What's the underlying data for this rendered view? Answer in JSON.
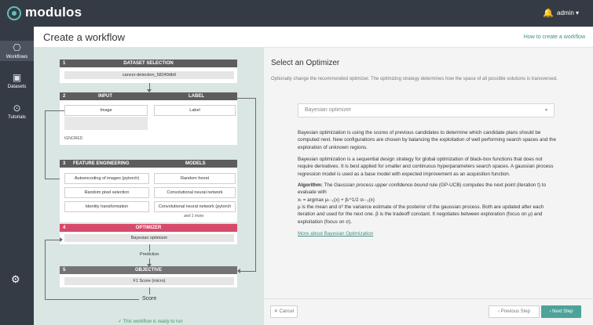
{
  "app": {
    "name": "modulos",
    "user": "admin",
    "user_caret": "▾"
  },
  "sidebar": {
    "items": [
      {
        "label": "Workflows",
        "icon": "workflow-icon"
      },
      {
        "label": "Datasets",
        "icon": "dataset-icon"
      },
      {
        "label": "Tutorials",
        "icon": "tutorials-icon"
      }
    ],
    "settings_icon": "gear-icon"
  },
  "header": {
    "title": "Create a workflow",
    "help_link": "How to create a workflow"
  },
  "diagram": {
    "dataset": {
      "num": "1",
      "title": "DATASET SELECTION",
      "value": "cancer-detection_58249db9"
    },
    "io": {
      "num": "2",
      "input_title": "INPUT",
      "label_title": "LABEL",
      "input": "Image",
      "label": "Label",
      "ignored": "IGNORED"
    },
    "fe": {
      "num": "3",
      "title": "FEATURE ENGINEERING",
      "models_title": "MODELS",
      "features": [
        "Autoencoding of images (pytorch)",
        "Random pixel selection",
        "Identity transformation"
      ],
      "models": [
        "Random forest",
        "Convolutional neural network",
        "Convolutional neural network (pytorch"
      ],
      "more": "and 1 more"
    },
    "optimizer": {
      "num": "4",
      "title": "OPTIMIZER",
      "value": "Bayesian optimizer"
    },
    "prediction": "Prediction",
    "objective": {
      "num": "5",
      "title": "OBJECTIVE",
      "value": "F1 Score (micro)"
    },
    "score": "Score",
    "ready": "✓ This workflow is ready to run"
  },
  "panel": {
    "title": "Select an Optimizer",
    "subtitle": "Optionally change the recommended optimizer. The optimizing strategy determines how the space of all possible solutions is transversed.",
    "select_value": "Bayesian optimizer",
    "p1": "Bayesian optimization is using the scores of previous candidates to determine which candidate plans should be computed next. New configurations are chosen by balancing the exploitation of well performing search spaces and the exploration of unknown regions.",
    "p2": "Bayesian optimization is a sequential design strategy for global optimization of black-box functions that does not require derivatives. It is best applied for smaller and continuous hyperparameters search spaces. A gaussian process regression model is used as a base model with expected improvement as an acquisition function.",
    "algo_label": "Algorithm:",
    "algo_pre": " The ",
    "algo_italic": "Gaussian process upper confidence bound",
    "algo_post": " rule (GP-UCB) computes the next point (iteration t) to evaluate with",
    "formula": "xₜ = argmax μₜ₋₁(x) + βₜ^1/2 σₜ₋₁(x)",
    "p3": "μ is the mean and σ² the variance estimate of the posterior of the gaussian process. Both are updated after each iteration and used for the next one. β is the tradeoff constant. It negotiates between exploration (focus on μ) and exploitation (focus on σ).",
    "more_link": "More about Bayesian Optimization"
  },
  "footer": {
    "cancel": "✕  Cancel",
    "previous": "‹  Previous Step",
    "next": "›  Next Step"
  }
}
